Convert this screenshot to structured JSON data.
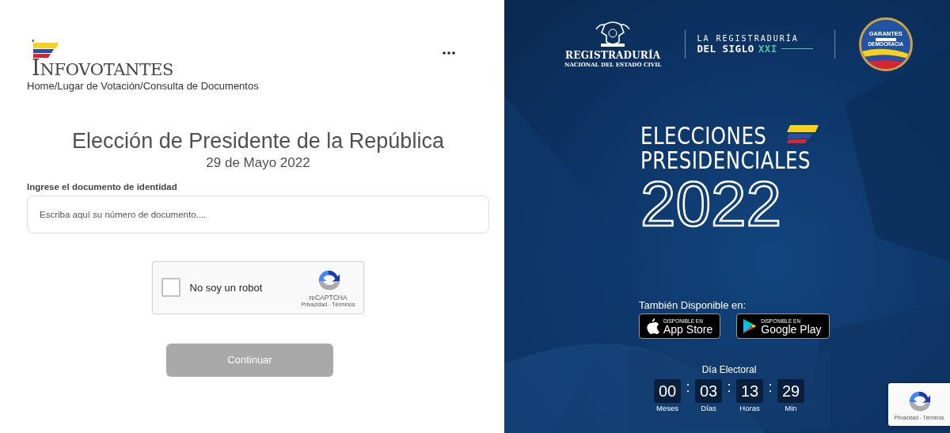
{
  "left": {
    "logo": "INFOVOTANTES",
    "breadcrumb": "Home/Lugar de Votación/Consulta de Documentos",
    "title": "Elección de Presidente de la República",
    "date": "29 de Mayo 2022",
    "id_field": {
      "label": "Ingrese el documento de identidad",
      "placeholder": "Escriba aquí su número de documento...."
    },
    "captcha": {
      "label": "No soy un robot",
      "checked": false,
      "brand": "reCAPTCHA",
      "links": "Privacidad - Términos"
    },
    "continue_button": {
      "label": "Continuar",
      "disabled": true
    }
  },
  "right": {
    "registraduria": {
      "name": "REGISTRADURÍA",
      "subtitle": "NACIONAL DEL ESTADO CIVIL"
    },
    "siglo": {
      "line1": "LA REGISTRADURÍA",
      "line2": "DEL SIGLO",
      "line3": "XXI"
    },
    "garantes": {
      "top": "GARANTES",
      "bottom": "DEMOCRACIA"
    },
    "headline": [
      "ELECCIONES",
      "PRESIDENCIALES"
    ],
    "year": "2022",
    "stores_label": "También Disponible en:",
    "stores": [
      {
        "kind": "apple",
        "small": "DISPONIBLE EN",
        "name": "App Store"
      },
      {
        "kind": "google",
        "small": "DISPONIBLE EN",
        "name": "Google Play"
      }
    ],
    "countdown": {
      "title": "Día Electoral",
      "separator": ":",
      "units": [
        {
          "value": "00",
          "unit": "Meses"
        },
        {
          "value": "03",
          "unit": "Días"
        },
        {
          "value": "13",
          "unit": "Horas"
        },
        {
          "value": "29",
          "unit": "Min"
        }
      ]
    },
    "badge_links": "Privacidad - Términos"
  }
}
